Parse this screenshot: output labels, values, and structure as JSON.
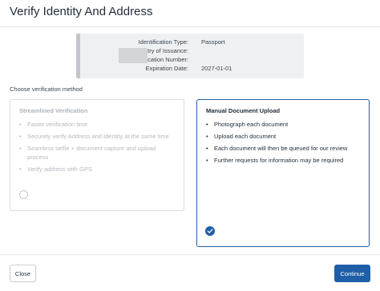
{
  "dialog": {
    "title": "Verify Identity And Address"
  },
  "identity": {
    "rows": [
      {
        "label": "Identification Type:",
        "value": "Passport"
      },
      {
        "label": "Country of Issuance:",
        "value": ""
      },
      {
        "label": "Identification Number:",
        "value": ""
      },
      {
        "label": "Expiration Date:",
        "value": "2027-01-01"
      }
    ]
  },
  "method": {
    "prompt": "Choose verification method",
    "options": [
      {
        "title": "Streamlined Verification",
        "selected": false,
        "features": [
          "Faster verification time",
          "Securely verify Address and Identity at the same time",
          "Seamless selfie + document capture and upload process",
          "Verify address with GPS"
        ]
      },
      {
        "title": "Manual Document Upload",
        "selected": true,
        "features": [
          "Photograph each document",
          "Upload each document",
          "Each document will then be queued for our review",
          "Further requests for information may be required"
        ]
      }
    ]
  },
  "footer": {
    "close_label": "Close",
    "continue_label": "Continue"
  },
  "colors": {
    "accent": "#1f5fa8",
    "disabled_text": "#b4b9be",
    "panel_bg": "#eef0f2"
  },
  "icons": {
    "selected_radio": "check-circle-icon",
    "unselected_radio": "radio-empty-icon"
  }
}
